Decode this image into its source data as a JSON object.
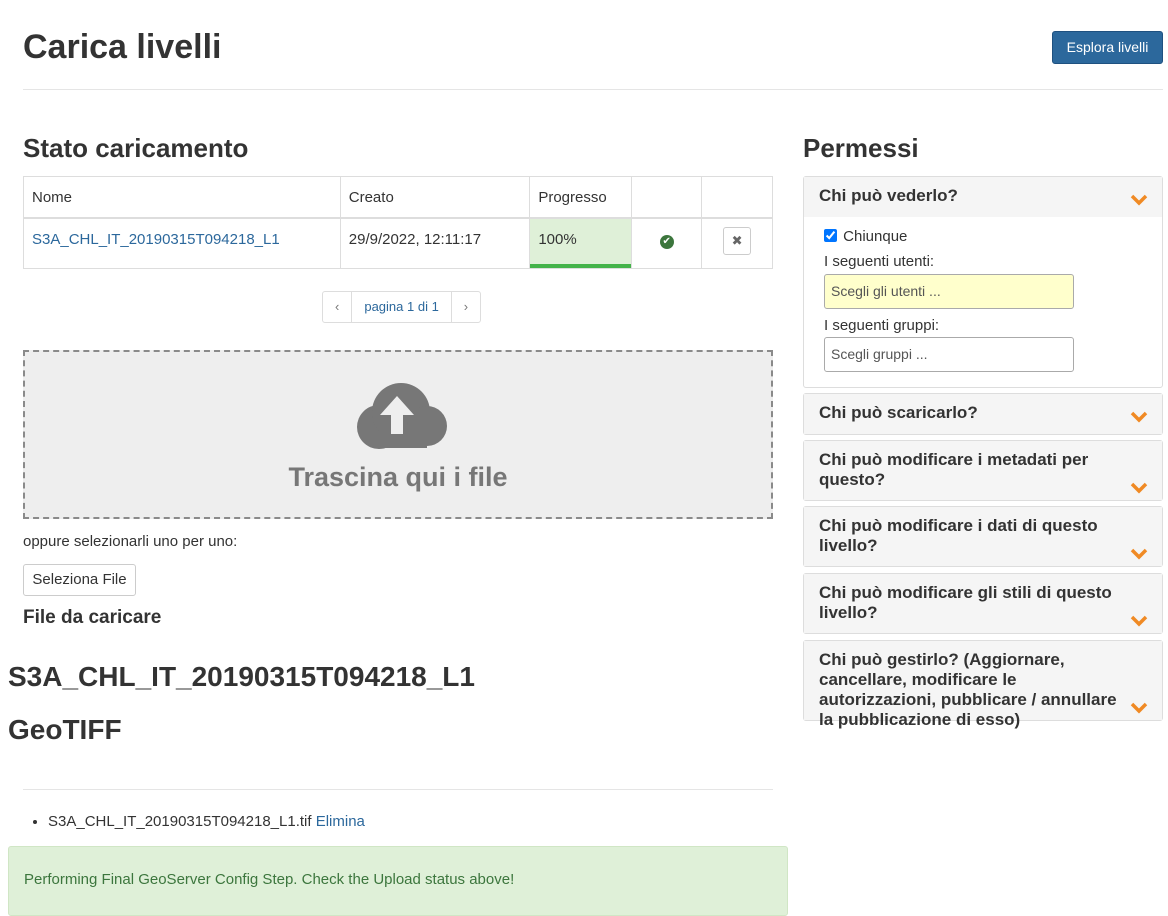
{
  "header": {
    "title": "Carica livelli",
    "explore_label": "Esplora livelli"
  },
  "upload_status": {
    "title": "Stato caricamento",
    "columns": [
      "Nome",
      "Creato",
      "Progresso"
    ],
    "rows": [
      {
        "name": "S3A_CHL_IT_20190315T094218_L1",
        "created": "29/9/2022, 12:11:17",
        "progress": "100%",
        "progress_fraction": 1.0
      }
    ],
    "pager": {
      "prev": "‹",
      "label": "pagina 1 di 1",
      "next": "›"
    }
  },
  "dropzone": {
    "text": "Trascina qui i file",
    "icon": "cloud-upload-icon"
  },
  "file_select": {
    "or_text": "oppure selezionarli uno per uno:",
    "button_label": "Seleziona File"
  },
  "files": {
    "title": "File da caricare",
    "name": "S3A_CHL_IT_20190315T094218_L1",
    "type": "GeoTIFF",
    "items": [
      {
        "filename": "S3A_CHL_IT_20190315T094218_L1.tif",
        "action": "Elimina"
      }
    ]
  },
  "alert": {
    "text": "Performing Final GeoServer Config Step. Check the Upload status above!"
  },
  "permissions": {
    "title": "Permessi",
    "view": {
      "title": "Chi può vederlo?",
      "anyone_label": "Chiunque",
      "anyone_checked": true,
      "users_label": "I seguenti utenti:",
      "users_placeholder": "Scegli gli utenti ...",
      "groups_label": "I seguenti gruppi:",
      "groups_placeholder": "Scegli gruppi ..."
    },
    "panels": [
      "Chi può scaricarlo?",
      "Chi può modificare i metadati per questo?",
      "Chi può modificare i dati di questo livello?",
      "Chi può modificare gli stili di questo livello?",
      "Chi può gestirlo? (Aggiornare, cancellare, modificare le autorizzazioni, pubblicare / annullare la pubblicazione di esso)"
    ]
  },
  "colors": {
    "accent": "#2c689c",
    "chevron": "#f08a24",
    "success": "#3c763d",
    "progress": "#44b34a"
  }
}
